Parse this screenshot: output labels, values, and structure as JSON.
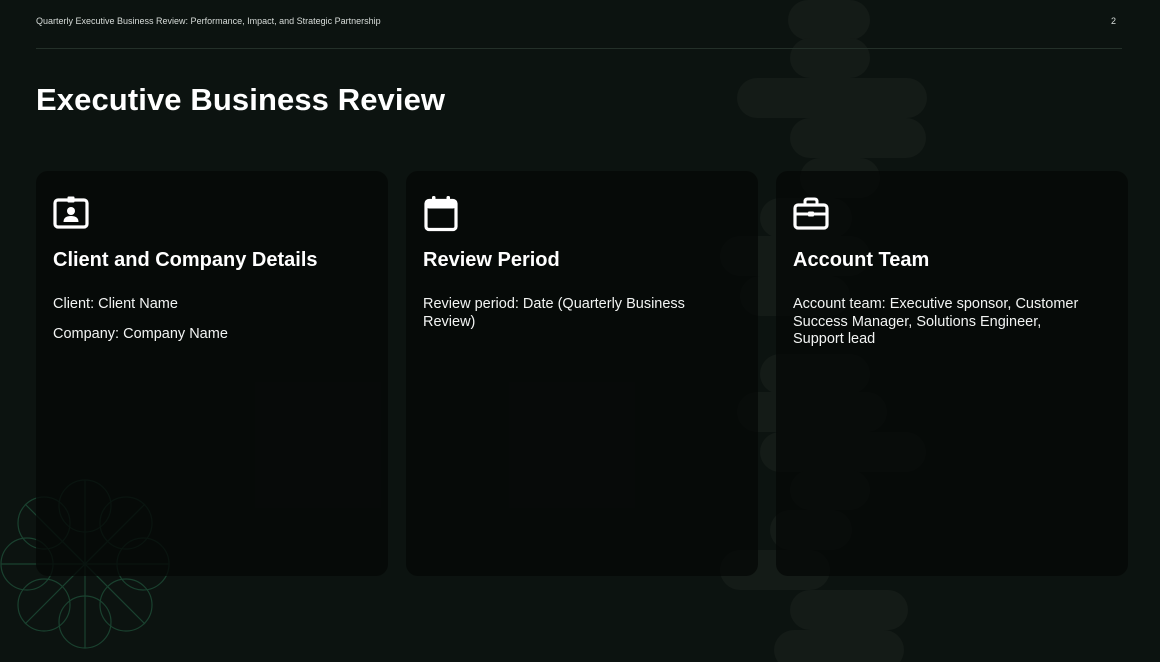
{
  "header": {
    "deck_title": "Quarterly Executive Business Review: Performance, Impact, and Strategic Partnership",
    "page_number": "2"
  },
  "slide": {
    "title": "Executive Business Review"
  },
  "cards": [
    {
      "icon": "id-badge-icon",
      "title": "Client and Company Details",
      "lines": [
        "Client: Client Name",
        "Company: Company Name"
      ]
    },
    {
      "icon": "calendar-icon",
      "title": "Review Period",
      "lines": [
        "Review period: Date (Quarterly Business Review)"
      ]
    },
    {
      "icon": "briefcase-icon",
      "title": "Account Team",
      "lines": [
        "Account team: Executive sponsor, Customer Success Manager, Solutions Engineer, Support lead"
      ]
    }
  ],
  "colors": {
    "background": "#0c1310",
    "card": "#050807",
    "decor": "#141b17",
    "accent_green": "#1d4a35",
    "text": "#ffffff"
  }
}
